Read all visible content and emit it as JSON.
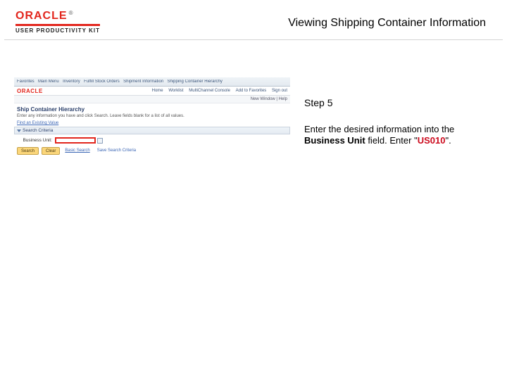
{
  "logo": {
    "brand": "ORACLE",
    "tm": "®",
    "subline": "USER PRODUCTIVITY KIT"
  },
  "header": {
    "title": "Viewing Shipping Container Information"
  },
  "instruction": {
    "step": "Step 5",
    "seg1": "Enter the desired information into the ",
    "field": "Business Unit",
    "seg2": " field. Enter ",
    "value": "US010"
  },
  "app": {
    "brand": "ORACLE",
    "breadcrumb": [
      "Favorites",
      "Main Menu",
      "Inventory",
      "Fulfill Stock Orders",
      "Shipment Information",
      "Shipping Container Hierarchy"
    ],
    "nav": [
      "Home",
      "Worklist",
      "MultiChannel Console",
      "Add to Favorites",
      "Sign out"
    ],
    "subheader": "New Window | Help",
    "page_title": "Ship Container Hierarchy",
    "page_sub": "Enter any information you have and click Search. Leave fields blank for a list of all values.",
    "find_link": "Find an Existing Value",
    "section_title": "Search Criteria",
    "field_label": "Business Unit:",
    "field_value": "",
    "buttons": {
      "search": "Search",
      "clear": "Clear",
      "basic": "Basic Search",
      "save": "Save Search Criteria"
    }
  }
}
